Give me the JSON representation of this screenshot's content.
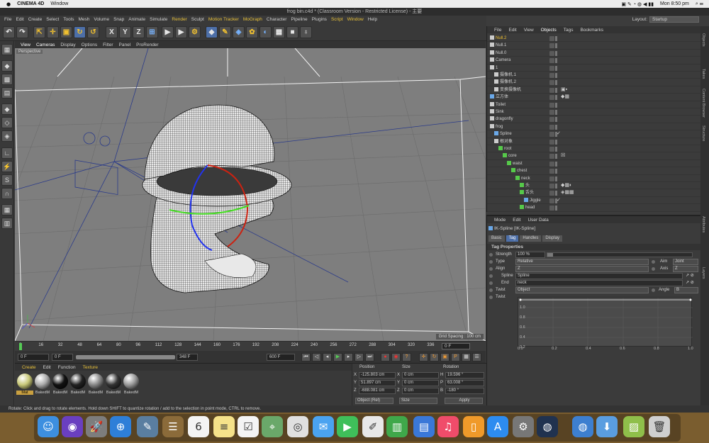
{
  "macbar": {
    "apple": "",
    "app_name": "CINEMA 4D",
    "menu_window": "Window",
    "clock": "Mon 8:50 pm"
  },
  "window": {
    "title": "frog bin.c4d * (Classroom Version - Restricted License) - 主要"
  },
  "menu": {
    "items": [
      "File",
      "Edit",
      "Create",
      "Select",
      "Tools",
      "Mesh",
      "Volume",
      "Snap",
      "Animate",
      "Simulate",
      "Render",
      "Sculpt",
      "Motion Tracker",
      "MoGraph",
      "Character",
      "Pipeline",
      "Plugins",
      "Script",
      "Window",
      "Help"
    ]
  },
  "layout": {
    "label": "Layout:",
    "value": "Startup"
  },
  "viewport": {
    "menu": [
      "View",
      "Cameras",
      "Display",
      "Options",
      "Filter",
      "Panel",
      "ProRender"
    ],
    "label": "Perspective",
    "grid_spacing": "Grid Spacing : 100 cm"
  },
  "timeline": {
    "ticks": [
      "0",
      "16",
      "32",
      "48",
      "64",
      "80",
      "96",
      "112",
      "128",
      "144",
      "160",
      "176",
      "192",
      "208",
      "224",
      "240",
      "256",
      "272",
      "288",
      "304",
      "320",
      "336"
    ],
    "current": "0 F"
  },
  "transport": {
    "start": "0 F",
    "min": "0 F",
    "max": "348 F",
    "end": "600 F"
  },
  "materials": {
    "tabs": [
      "Create",
      "Edit",
      "Function",
      "Texture"
    ],
    "items": [
      {
        "name": "Mat",
        "color": "#c8c878"
      },
      {
        "name": "BakedM",
        "color": "#aaaaaa"
      },
      {
        "name": "BakedM",
        "color": "#111111"
      },
      {
        "name": "BakedM",
        "color": "#222222"
      },
      {
        "name": "BakedM",
        "color": "#888888"
      },
      {
        "name": "BakedM",
        "color": "#333333"
      },
      {
        "name": "BakedM",
        "color": "#999999"
      }
    ]
  },
  "coords": {
    "headers": [
      "Position",
      "Size",
      "Rotation"
    ],
    "rows": [
      {
        "axis": "X",
        "pos": "-125.803 cm",
        "saxis": "X",
        "size": "0 cm",
        "raxis": "H",
        "rot": "19.596 °"
      },
      {
        "axis": "Y",
        "pos": "51.897 cm",
        "saxis": "Y",
        "size": "0 cm",
        "raxis": "P",
        "rot": "63.008 °"
      },
      {
        "axis": "Z",
        "pos": "-688.081 cm",
        "saxis": "Z",
        "size": "0 cm",
        "raxis": "B",
        "rot": "-180 °"
      }
    ],
    "mode": "Object (Rel)",
    "size_mode": "Size",
    "apply": "Apply"
  },
  "status": "Rotate: Click and drag to rotate elements. Hold down SHIFT to quantize rotation / add to the selection in point mode, CTRL to remove.",
  "objects": {
    "menu": [
      "File",
      "Edit",
      "View",
      "Objects",
      "Tags",
      "Bookmarks"
    ],
    "rows": [
      {
        "name": "Null.2",
        "indent": 0,
        "selected": true,
        "icon": "null"
      },
      {
        "name": "Null.1",
        "indent": 0,
        "icon": "null"
      },
      {
        "name": "Null.0",
        "indent": 0,
        "icon": "null"
      },
      {
        "name": "Camera",
        "indent": 0,
        "icon": "camera"
      },
      {
        "name": "1",
        "indent": 0,
        "icon": "null"
      },
      {
        "name": "摄像机.1",
        "indent": 1,
        "icon": "camera"
      },
      {
        "name": "摄像机.2",
        "indent": 1,
        "icon": "camera"
      },
      {
        "name": "变换摄像机",
        "indent": 1,
        "icon": "camera",
        "tags": "▣▪"
      },
      {
        "name": "立方体",
        "indent": 0,
        "icon": "cube",
        "tags": "◆▦"
      },
      {
        "name": "Toilet",
        "indent": 0,
        "icon": "null"
      },
      {
        "name": "Sink",
        "indent": 0,
        "icon": "null"
      },
      {
        "name": "dragonfly",
        "indent": 0,
        "icon": "null"
      },
      {
        "name": "frog",
        "indent": 0,
        "icon": "null"
      },
      {
        "name": "Spline",
        "indent": 1,
        "icon": "spline",
        "tags": "✓"
      },
      {
        "name": "根对象",
        "indent": 1,
        "icon": "null"
      },
      {
        "name": "root",
        "indent": 2,
        "icon": "joint"
      },
      {
        "name": "core",
        "indent": 3,
        "icon": "joint",
        "tags": "☒"
      },
      {
        "name": "waist",
        "indent": 4,
        "icon": "joint"
      },
      {
        "name": "chest",
        "indent": 5,
        "icon": "joint"
      },
      {
        "name": "neck",
        "indent": 6,
        "icon": "joint"
      },
      {
        "name": "头",
        "indent": 7,
        "icon": "joint",
        "tags": "◆▦◐"
      },
      {
        "name": "舌头",
        "indent": 7,
        "icon": "joint",
        "tags": "◈▦▦"
      },
      {
        "name": "Jiggle",
        "indent": 8,
        "icon": "deform",
        "tags": "✓"
      },
      {
        "name": "head",
        "indent": 7,
        "icon": "joint"
      }
    ]
  },
  "attributes": {
    "menu": [
      "Mode",
      "Edit",
      "User Data"
    ],
    "title": "IK-Spline [IK-Spline]",
    "tabs": [
      "Basic",
      "Tag",
      "Handles",
      "Display"
    ],
    "section": "Tag Properties",
    "strength_label": "Strength",
    "strength_value": "100 %",
    "strength": 1.0,
    "type_label": "Type",
    "type_value": "Relative",
    "aim_label": "Aim",
    "aim_value": "Joint",
    "align_label": "Align",
    "align_value": "Z",
    "axis_label": "Axis",
    "axis_value": "Z",
    "spline_label": "Spline",
    "spline_value": "Spline",
    "end_label": "End",
    "end_value": "neck",
    "twist_label": "Twist",
    "twist_value": "Object",
    "angle_label": "Angle",
    "angle_value": "B",
    "twist2_label": "Twist",
    "graph_y": [
      "1.0",
      "0.8",
      "0.6",
      "0.4",
      "0.2"
    ],
    "graph_x": [
      "0.0",
      "0.2",
      "0.4",
      "0.6",
      "0.8",
      "1.0"
    ]
  },
  "rstrip": [
    "Objects",
    "Takes",
    "Content Browser",
    "Structure",
    "Attributes",
    "Layers"
  ],
  "dock": [
    {
      "name": "finder",
      "color": "#3d8fe0",
      "glyph": "☺"
    },
    {
      "name": "siri",
      "color": "#6a3fc0",
      "glyph": "◉"
    },
    {
      "name": "launchpad",
      "color": "#7d7d7d",
      "glyph": "🚀"
    },
    {
      "name": "safari",
      "color": "#2e7fd8",
      "glyph": "⊕"
    },
    {
      "name": "preview",
      "color": "#5a7ea0",
      "glyph": "✎"
    },
    {
      "name": "contacts",
      "color": "#8b6b3a",
      "glyph": "☰"
    },
    {
      "name": "calendar",
      "color": "#f4f4f4",
      "glyph": "6"
    },
    {
      "name": "notes",
      "color": "#f5e28a",
      "glyph": "≡"
    },
    {
      "name": "reminders",
      "color": "#f4f4f4",
      "glyph": "☑"
    },
    {
      "name": "maps",
      "color": "#6aa86a",
      "glyph": "⌖"
    },
    {
      "name": "photos-booth",
      "color": "#e0e0e0",
      "glyph": "◎"
    },
    {
      "name": "photos",
      "color": "#f3f3f3",
      "glyph": "✿"
    },
    {
      "name": "messages",
      "color": "#4aa3f0",
      "glyph": "✉"
    },
    {
      "name": "facetime",
      "color": "#3fbf5a",
      "glyph": "▶"
    },
    {
      "name": "pages",
      "color": "#e8e8e8",
      "glyph": "✐"
    },
    {
      "name": "numbers",
      "color": "#3fa84a",
      "glyph": "▥"
    },
    {
      "name": "keynote",
      "color": "#3a78d8",
      "glyph": "▤"
    },
    {
      "name": "music",
      "color": "#f04c6a",
      "glyph": "♫"
    },
    {
      "name": "books",
      "color": "#f09a2a",
      "glyph": "▯"
    },
    {
      "name": "app-store",
      "color": "#2d8cf0",
      "glyph": "A"
    },
    {
      "name": "system-preferences",
      "color": "#777777",
      "glyph": "⚙"
    },
    {
      "name": "cinema4d",
      "color": "#20324f",
      "glyph": "◍"
    },
    {
      "name": "network",
      "color": "#3d7fd0",
      "glyph": "◍"
    },
    {
      "name": "downloads",
      "color": "#5a9de0",
      "glyph": "⬇"
    },
    {
      "name": "folder",
      "color": "#8fbf4a",
      "glyph": "▨"
    },
    {
      "name": "trash",
      "color": "#cfcfcf",
      "glyph": "🗑"
    }
  ]
}
